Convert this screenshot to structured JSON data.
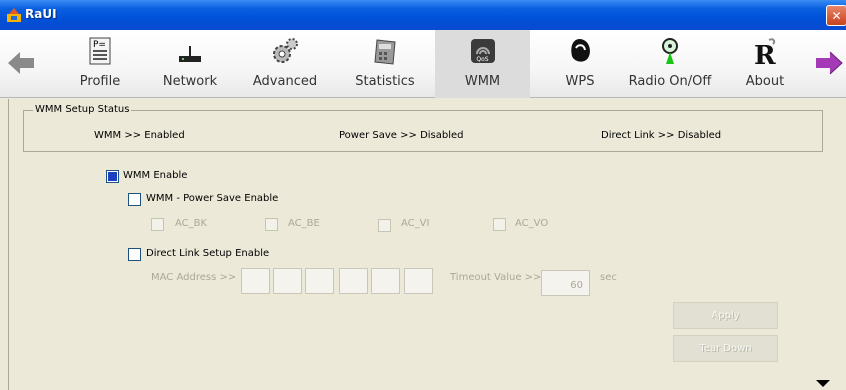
{
  "window": {
    "title": "RaUI",
    "close_glyph": "✕"
  },
  "toolbar": {
    "items": [
      {
        "label": "Profile",
        "icon": "profile-icon"
      },
      {
        "label": "Network",
        "icon": "network-icon"
      },
      {
        "label": "Advanced",
        "icon": "advanced-icon"
      },
      {
        "label": "Statistics",
        "icon": "statistics-icon"
      },
      {
        "label": "WMM",
        "icon": "wmm-icon",
        "active": true
      },
      {
        "label": "WPS",
        "icon": "wps-icon"
      },
      {
        "label": "Radio On/Off",
        "icon": "radio-icon"
      },
      {
        "label": "About",
        "icon": "about-icon"
      }
    ],
    "back_icon": "back-arrow-icon",
    "forward_icon": "forward-arrow-icon",
    "wmm_badge": "QoS"
  },
  "status_group": {
    "title": "WMM Setup Status",
    "wmm": "WMM >> Enabled",
    "power_save": "Power Save >> Disabled",
    "direct_link": "Direct Link >> Disabled"
  },
  "settings": {
    "wmm_enable": {
      "label": "WMM Enable",
      "checked": true
    },
    "power_save_enable": {
      "label": "WMM - Power Save Enable",
      "checked": false
    },
    "ac_options": [
      {
        "label": "AC_BK",
        "checked": false,
        "enabled": false
      },
      {
        "label": "AC_BE",
        "checked": false,
        "enabled": false
      },
      {
        "label": "AC_VI",
        "checked": false,
        "enabled": false
      },
      {
        "label": "AC_VO",
        "checked": false,
        "enabled": false
      }
    ],
    "direct_link_enable": {
      "label": "Direct Link Setup Enable",
      "checked": false
    },
    "mac_address_label": "MAC Address >>",
    "mac_octets": [
      "",
      "",
      "",
      "",
      "",
      ""
    ],
    "timeout_label": "Timeout Value >>",
    "timeout_value": "60",
    "timeout_unit": "sec"
  },
  "buttons": {
    "apply": "Apply",
    "tear_down": "Tear Down"
  },
  "colors": {
    "titlebar": "#0a5fe0",
    "background": "#ece9d8",
    "checked": "#1d3fc2"
  }
}
